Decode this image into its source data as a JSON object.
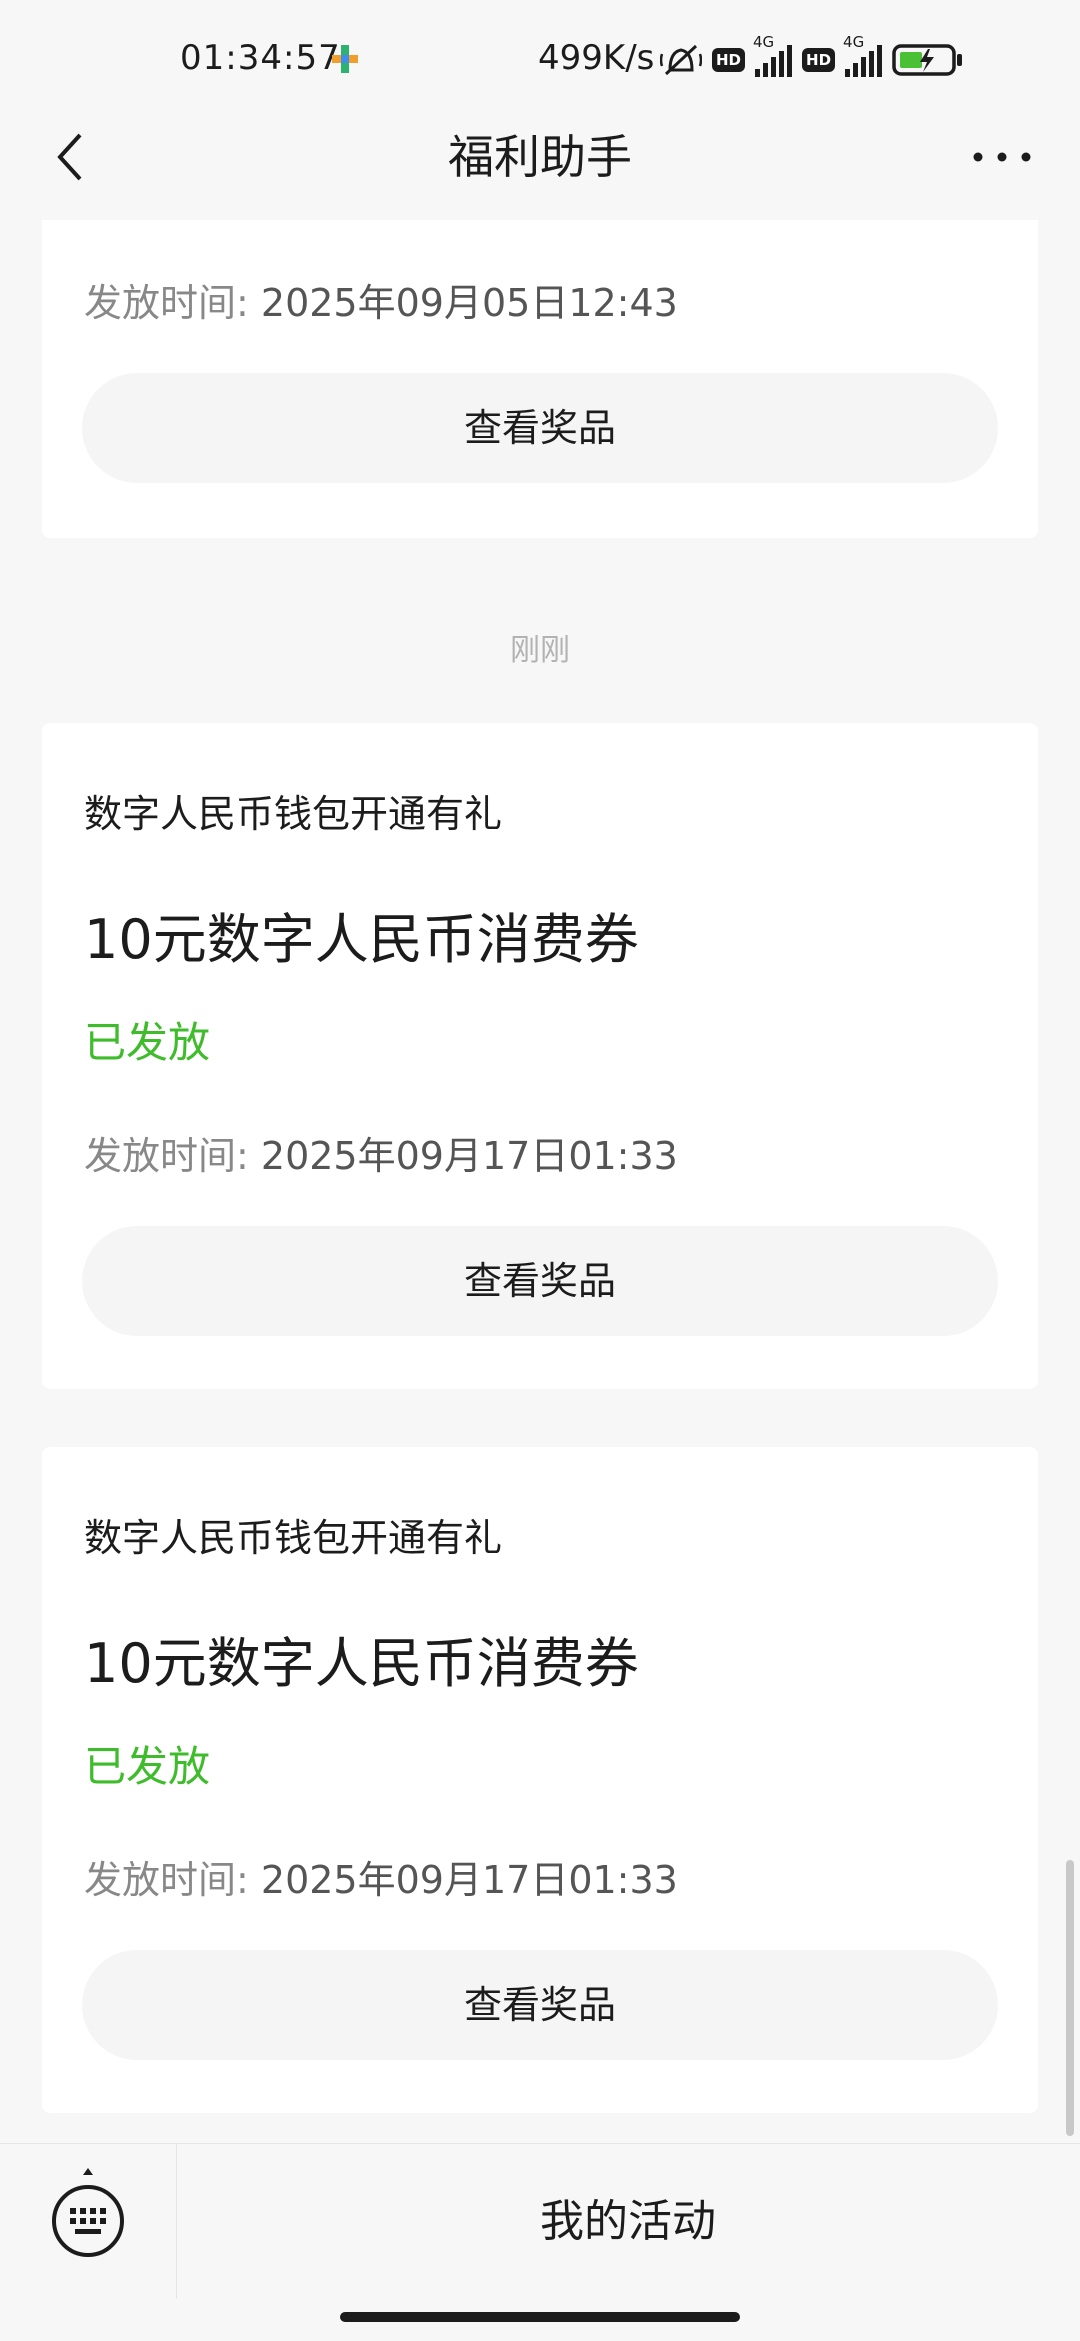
{
  "status_bar": {
    "time": "01:34:57",
    "net_speed": "499K/s",
    "hd_label": "HD",
    "network_label": "4G",
    "icons": [
      "app-notification-icon",
      "mute-icon",
      "hd-icon",
      "signal-icon",
      "hd-icon",
      "signal-icon",
      "battery-charging-icon"
    ]
  },
  "nav": {
    "title": "福利助手",
    "back_icon": "chevron-left-icon",
    "more_icon": "more-dots-icon"
  },
  "cards": [
    {
      "time_label": "发放时间:",
      "time_value": "2025年09月05日12:43",
      "button": "查看奖品"
    },
    {
      "title": "数字人民币钱包开通有礼",
      "prize": "10元数字人民币消费券",
      "status": "已发放",
      "time_label": "发放时间:",
      "time_value": "2025年09月17日01:33",
      "button": "查看奖品"
    },
    {
      "title": "数字人民币钱包开通有礼",
      "prize": "10元数字人民币消费券",
      "status": "已发放",
      "time_label": "发放时间:",
      "time_value": "2025年09月17日01:33",
      "button": "查看奖品"
    }
  ],
  "divider_time": "刚刚",
  "bottom_bar": {
    "keyboard_icon": "keyboard-icon",
    "menu_label": "我的活动"
  },
  "colors": {
    "status_green": "#3fbc2b",
    "background": "#f7f7f7",
    "card": "#ffffff"
  }
}
